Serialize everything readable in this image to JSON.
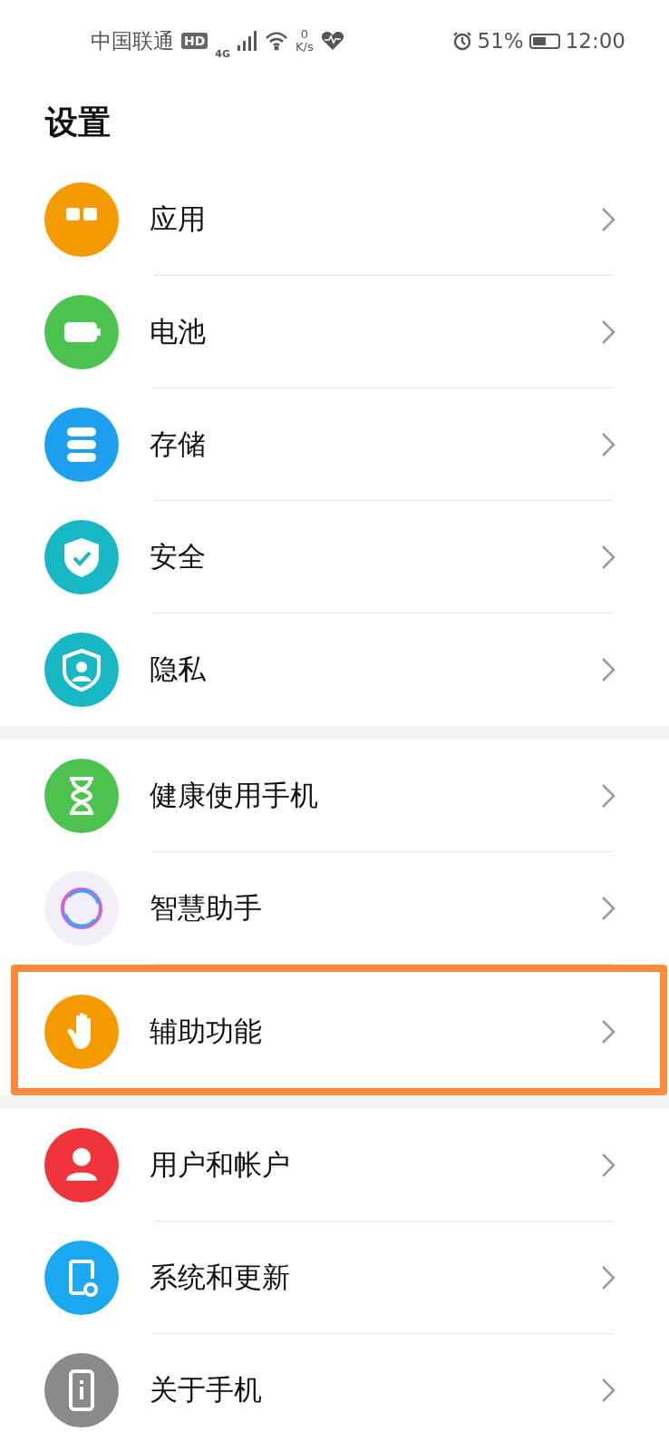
{
  "status_bar": {
    "carrier": "中国联通",
    "hd": "HD",
    "network": "4G",
    "speed_value": "0",
    "speed_unit": "K/s",
    "battery_percent": "51%",
    "time": "12:00"
  },
  "title": "设置",
  "sections": [
    {
      "items": [
        {
          "label": "应用",
          "kind": "apps",
          "color": "#f59a00",
          "highlighted": false
        },
        {
          "label": "电池",
          "kind": "battery",
          "color": "#4cc34e",
          "highlighted": false
        },
        {
          "label": "存储",
          "kind": "storage",
          "color": "#1ea0f0",
          "highlighted": false
        },
        {
          "label": "安全",
          "kind": "security",
          "color": "#17b8c4",
          "highlighted": false
        },
        {
          "label": "隐私",
          "kind": "privacy",
          "color": "#17b8c4",
          "highlighted": false
        }
      ]
    },
    {
      "items": [
        {
          "label": "健康使用手机",
          "kind": "hourglass",
          "color": "#4cc34e",
          "highlighted": false
        },
        {
          "label": "智慧助手",
          "kind": "ring",
          "color": "#f3eef8",
          "highlighted": false
        },
        {
          "label": "辅助功能",
          "kind": "hand",
          "color": "#f59a00",
          "highlighted": true
        }
      ]
    },
    {
      "items": [
        {
          "label": "用户和帐户",
          "kind": "user",
          "color": "#f0343c",
          "highlighted": false
        },
        {
          "label": "系统和更新",
          "kind": "phone-gear",
          "color": "#1aa8f0",
          "highlighted": false
        },
        {
          "label": "关于手机",
          "kind": "phone-info",
          "color": "#8a8a8a",
          "highlighted": false
        }
      ]
    }
  ]
}
